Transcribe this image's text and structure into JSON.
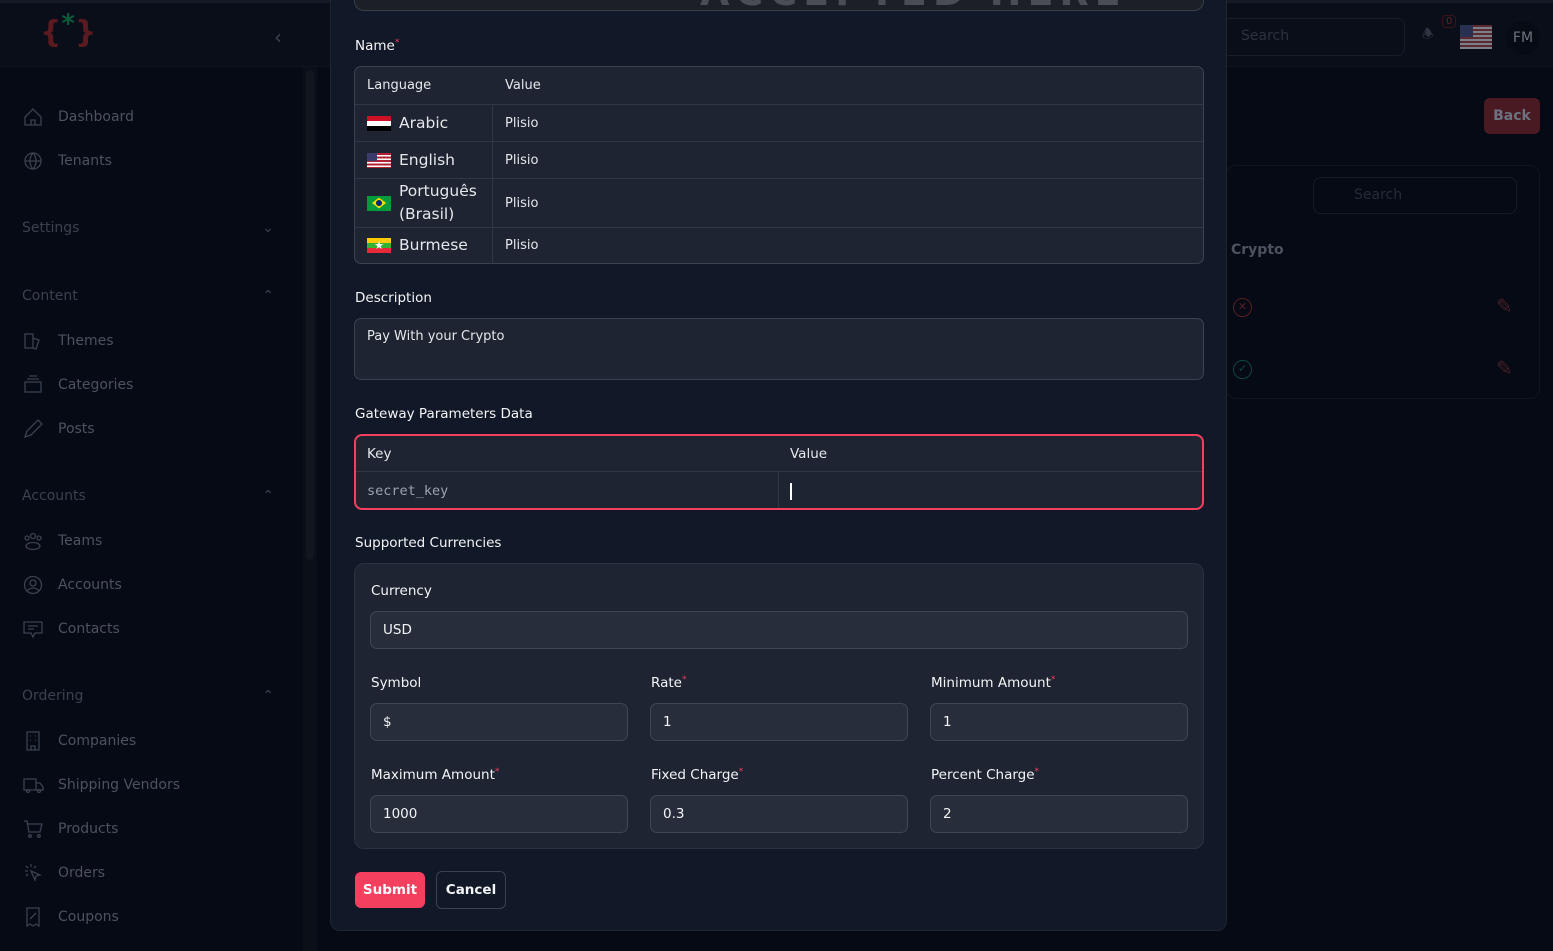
{
  "header": {
    "logo_text": "{*}",
    "search_placeholder": "Search",
    "notification_count": "0",
    "user_initials": "FM"
  },
  "sidebar": {
    "items_top": [
      {
        "label": "Dashboard",
        "icon": "home-icon"
      },
      {
        "label": "Tenants",
        "icon": "globe-icon"
      }
    ],
    "sections": [
      {
        "title": "Settings",
        "expanded": false,
        "items": []
      },
      {
        "title": "Content",
        "expanded": true,
        "items": [
          {
            "label": "Themes",
            "icon": "themes-icon"
          },
          {
            "label": "Categories",
            "icon": "categories-icon"
          },
          {
            "label": "Posts",
            "icon": "pencil-icon"
          }
        ]
      },
      {
        "title": "Accounts",
        "expanded": true,
        "items": [
          {
            "label": "Teams",
            "icon": "teams-icon"
          },
          {
            "label": "Accounts",
            "icon": "user-circle-icon"
          },
          {
            "label": "Contacts",
            "icon": "chat-icon"
          }
        ]
      },
      {
        "title": "Ordering",
        "expanded": true,
        "items": [
          {
            "label": "Companies",
            "icon": "building-icon"
          },
          {
            "label": "Shipping Vendors",
            "icon": "truck-icon"
          },
          {
            "label": "Products",
            "icon": "cart-icon"
          },
          {
            "label": "Orders",
            "icon": "cursor-click-icon"
          },
          {
            "label": "Coupons",
            "icon": "coupon-icon"
          }
        ]
      }
    ]
  },
  "background_page": {
    "back_label": "Back",
    "search_placeholder": "Search",
    "column_crypto": "Crypto",
    "rows": [
      {
        "crypto": false
      },
      {
        "crypto": true
      }
    ]
  },
  "modal": {
    "banner_text": "ACCEPTED HERE",
    "name_label": "Name",
    "name_table": {
      "headers": [
        "Language",
        "Value"
      ],
      "rows": [
        {
          "language": "Arabic",
          "flag": "eg",
          "value": "Plisio"
        },
        {
          "language": "English",
          "flag": "us",
          "value": "Plisio"
        },
        {
          "language": "Português (Brasil)",
          "flag": "br",
          "value": "Plisio"
        },
        {
          "language": "Burmese",
          "flag": "mm",
          "value": "Plisio"
        }
      ]
    },
    "description_label": "Description",
    "description_value": "Pay With your Crypto",
    "gateway_label": "Gateway Parameters Data",
    "gateway_table": {
      "headers": [
        "Key",
        "Value"
      ],
      "rows": [
        {
          "key": "secret_key",
          "value": ""
        }
      ]
    },
    "currencies_label": "Supported Currencies",
    "currency": {
      "label": "Currency",
      "value": "USD"
    },
    "fields": [
      {
        "label": "Symbol",
        "value": "$",
        "required": false
      },
      {
        "label": "Rate",
        "value": "1",
        "required": true
      },
      {
        "label": "Minimum Amount",
        "value": "1",
        "required": true
      },
      {
        "label": "Maximum Amount",
        "value": "1000",
        "required": true
      },
      {
        "label": "Fixed Charge",
        "value": "0.3",
        "required": true
      },
      {
        "label": "Percent Charge",
        "value": "2",
        "required": true
      }
    ],
    "submit_label": "Submit",
    "cancel_label": "Cancel",
    "accent_color": "#f43f5e"
  }
}
